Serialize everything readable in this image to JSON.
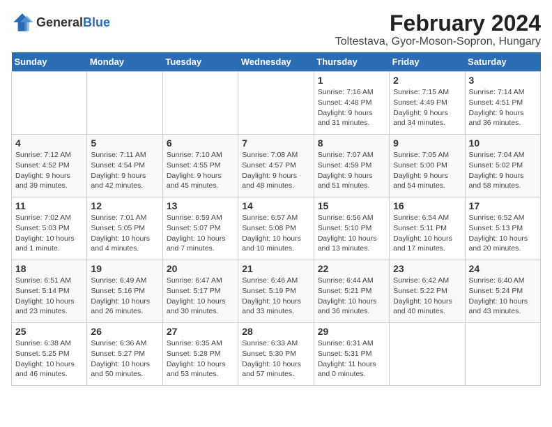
{
  "header": {
    "logo_general": "General",
    "logo_blue": "Blue",
    "title": "February 2024",
    "subtitle": "Toltestava, Gyor-Moson-Sopron, Hungary"
  },
  "calendar": {
    "days": [
      "Sunday",
      "Monday",
      "Tuesday",
      "Wednesday",
      "Thursday",
      "Friday",
      "Saturday"
    ],
    "weeks": [
      [
        {
          "date": "",
          "info": ""
        },
        {
          "date": "",
          "info": ""
        },
        {
          "date": "",
          "info": ""
        },
        {
          "date": "",
          "info": ""
        },
        {
          "date": "1",
          "info": "Sunrise: 7:16 AM\nSunset: 4:48 PM\nDaylight: 9 hours\nand 31 minutes."
        },
        {
          "date": "2",
          "info": "Sunrise: 7:15 AM\nSunset: 4:49 PM\nDaylight: 9 hours\nand 34 minutes."
        },
        {
          "date": "3",
          "info": "Sunrise: 7:14 AM\nSunset: 4:51 PM\nDaylight: 9 hours\nand 36 minutes."
        }
      ],
      [
        {
          "date": "4",
          "info": "Sunrise: 7:12 AM\nSunset: 4:52 PM\nDaylight: 9 hours\nand 39 minutes."
        },
        {
          "date": "5",
          "info": "Sunrise: 7:11 AM\nSunset: 4:54 PM\nDaylight: 9 hours\nand 42 minutes."
        },
        {
          "date": "6",
          "info": "Sunrise: 7:10 AM\nSunset: 4:55 PM\nDaylight: 9 hours\nand 45 minutes."
        },
        {
          "date": "7",
          "info": "Sunrise: 7:08 AM\nSunset: 4:57 PM\nDaylight: 9 hours\nand 48 minutes."
        },
        {
          "date": "8",
          "info": "Sunrise: 7:07 AM\nSunset: 4:59 PM\nDaylight: 9 hours\nand 51 minutes."
        },
        {
          "date": "9",
          "info": "Sunrise: 7:05 AM\nSunset: 5:00 PM\nDaylight: 9 hours\nand 54 minutes."
        },
        {
          "date": "10",
          "info": "Sunrise: 7:04 AM\nSunset: 5:02 PM\nDaylight: 9 hours\nand 58 minutes."
        }
      ],
      [
        {
          "date": "11",
          "info": "Sunrise: 7:02 AM\nSunset: 5:03 PM\nDaylight: 10 hours\nand 1 minute."
        },
        {
          "date": "12",
          "info": "Sunrise: 7:01 AM\nSunset: 5:05 PM\nDaylight: 10 hours\nand 4 minutes."
        },
        {
          "date": "13",
          "info": "Sunrise: 6:59 AM\nSunset: 5:07 PM\nDaylight: 10 hours\nand 7 minutes."
        },
        {
          "date": "14",
          "info": "Sunrise: 6:57 AM\nSunset: 5:08 PM\nDaylight: 10 hours\nand 10 minutes."
        },
        {
          "date": "15",
          "info": "Sunrise: 6:56 AM\nSunset: 5:10 PM\nDaylight: 10 hours\nand 13 minutes."
        },
        {
          "date": "16",
          "info": "Sunrise: 6:54 AM\nSunset: 5:11 PM\nDaylight: 10 hours\nand 17 minutes."
        },
        {
          "date": "17",
          "info": "Sunrise: 6:52 AM\nSunset: 5:13 PM\nDaylight: 10 hours\nand 20 minutes."
        }
      ],
      [
        {
          "date": "18",
          "info": "Sunrise: 6:51 AM\nSunset: 5:14 PM\nDaylight: 10 hours\nand 23 minutes."
        },
        {
          "date": "19",
          "info": "Sunrise: 6:49 AM\nSunset: 5:16 PM\nDaylight: 10 hours\nand 26 minutes."
        },
        {
          "date": "20",
          "info": "Sunrise: 6:47 AM\nSunset: 5:17 PM\nDaylight: 10 hours\nand 30 minutes."
        },
        {
          "date": "21",
          "info": "Sunrise: 6:46 AM\nSunset: 5:19 PM\nDaylight: 10 hours\nand 33 minutes."
        },
        {
          "date": "22",
          "info": "Sunrise: 6:44 AM\nSunset: 5:21 PM\nDaylight: 10 hours\nand 36 minutes."
        },
        {
          "date": "23",
          "info": "Sunrise: 6:42 AM\nSunset: 5:22 PM\nDaylight: 10 hours\nand 40 minutes."
        },
        {
          "date": "24",
          "info": "Sunrise: 6:40 AM\nSunset: 5:24 PM\nDaylight: 10 hours\nand 43 minutes."
        }
      ],
      [
        {
          "date": "25",
          "info": "Sunrise: 6:38 AM\nSunset: 5:25 PM\nDaylight: 10 hours\nand 46 minutes."
        },
        {
          "date": "26",
          "info": "Sunrise: 6:36 AM\nSunset: 5:27 PM\nDaylight: 10 hours\nand 50 minutes."
        },
        {
          "date": "27",
          "info": "Sunrise: 6:35 AM\nSunset: 5:28 PM\nDaylight: 10 hours\nand 53 minutes."
        },
        {
          "date": "28",
          "info": "Sunrise: 6:33 AM\nSunset: 5:30 PM\nDaylight: 10 hours\nand 57 minutes."
        },
        {
          "date": "29",
          "info": "Sunrise: 6:31 AM\nSunset: 5:31 PM\nDaylight: 11 hours\nand 0 minutes."
        },
        {
          "date": "",
          "info": ""
        },
        {
          "date": "",
          "info": ""
        }
      ]
    ]
  }
}
